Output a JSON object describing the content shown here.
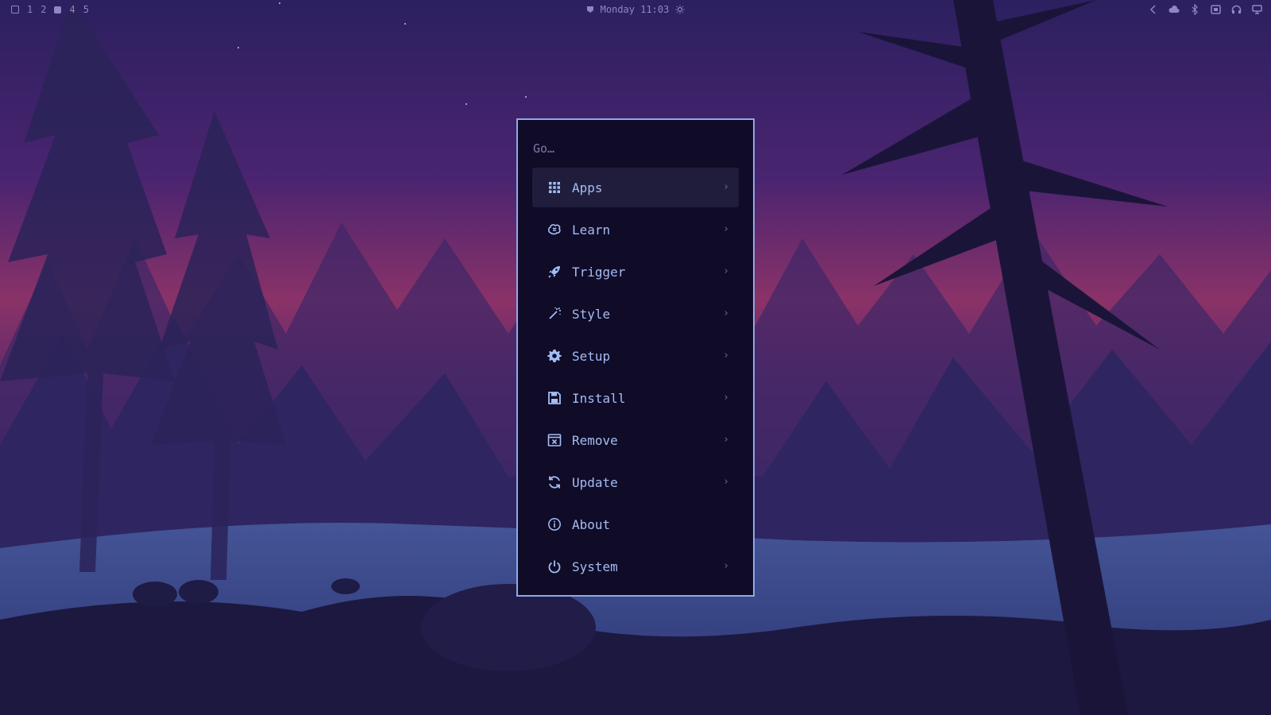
{
  "topbar": {
    "workspaces": [
      "1",
      "2",
      "4",
      "5"
    ],
    "clock": "Monday 11:03"
  },
  "menu": {
    "prompt": "Go…",
    "items": [
      {
        "label": "Apps",
        "icon": "grid-icon",
        "has_submenu": true,
        "selected": true
      },
      {
        "label": "Learn",
        "icon": "brain-icon",
        "has_submenu": true
      },
      {
        "label": "Trigger",
        "icon": "rocket-icon",
        "has_submenu": true
      },
      {
        "label": "Style",
        "icon": "wand-icon",
        "has_submenu": true
      },
      {
        "label": "Setup",
        "icon": "gear-icon",
        "has_submenu": true
      },
      {
        "label": "Install",
        "icon": "save-icon",
        "has_submenu": true
      },
      {
        "label": "Remove",
        "icon": "remove-window-icon",
        "has_submenu": true
      },
      {
        "label": "Update",
        "icon": "refresh-icon",
        "has_submenu": true
      },
      {
        "label": "About",
        "icon": "info-icon",
        "has_submenu": false
      },
      {
        "label": "System",
        "icon": "power-icon",
        "has_submenu": true
      }
    ],
    "chevron": "›"
  },
  "colors": {
    "menu_border": "#8ea8ee",
    "menu_bg": "#100b26",
    "item_text": "#a3bdf6",
    "selected_bg": "#1f1d3b"
  }
}
